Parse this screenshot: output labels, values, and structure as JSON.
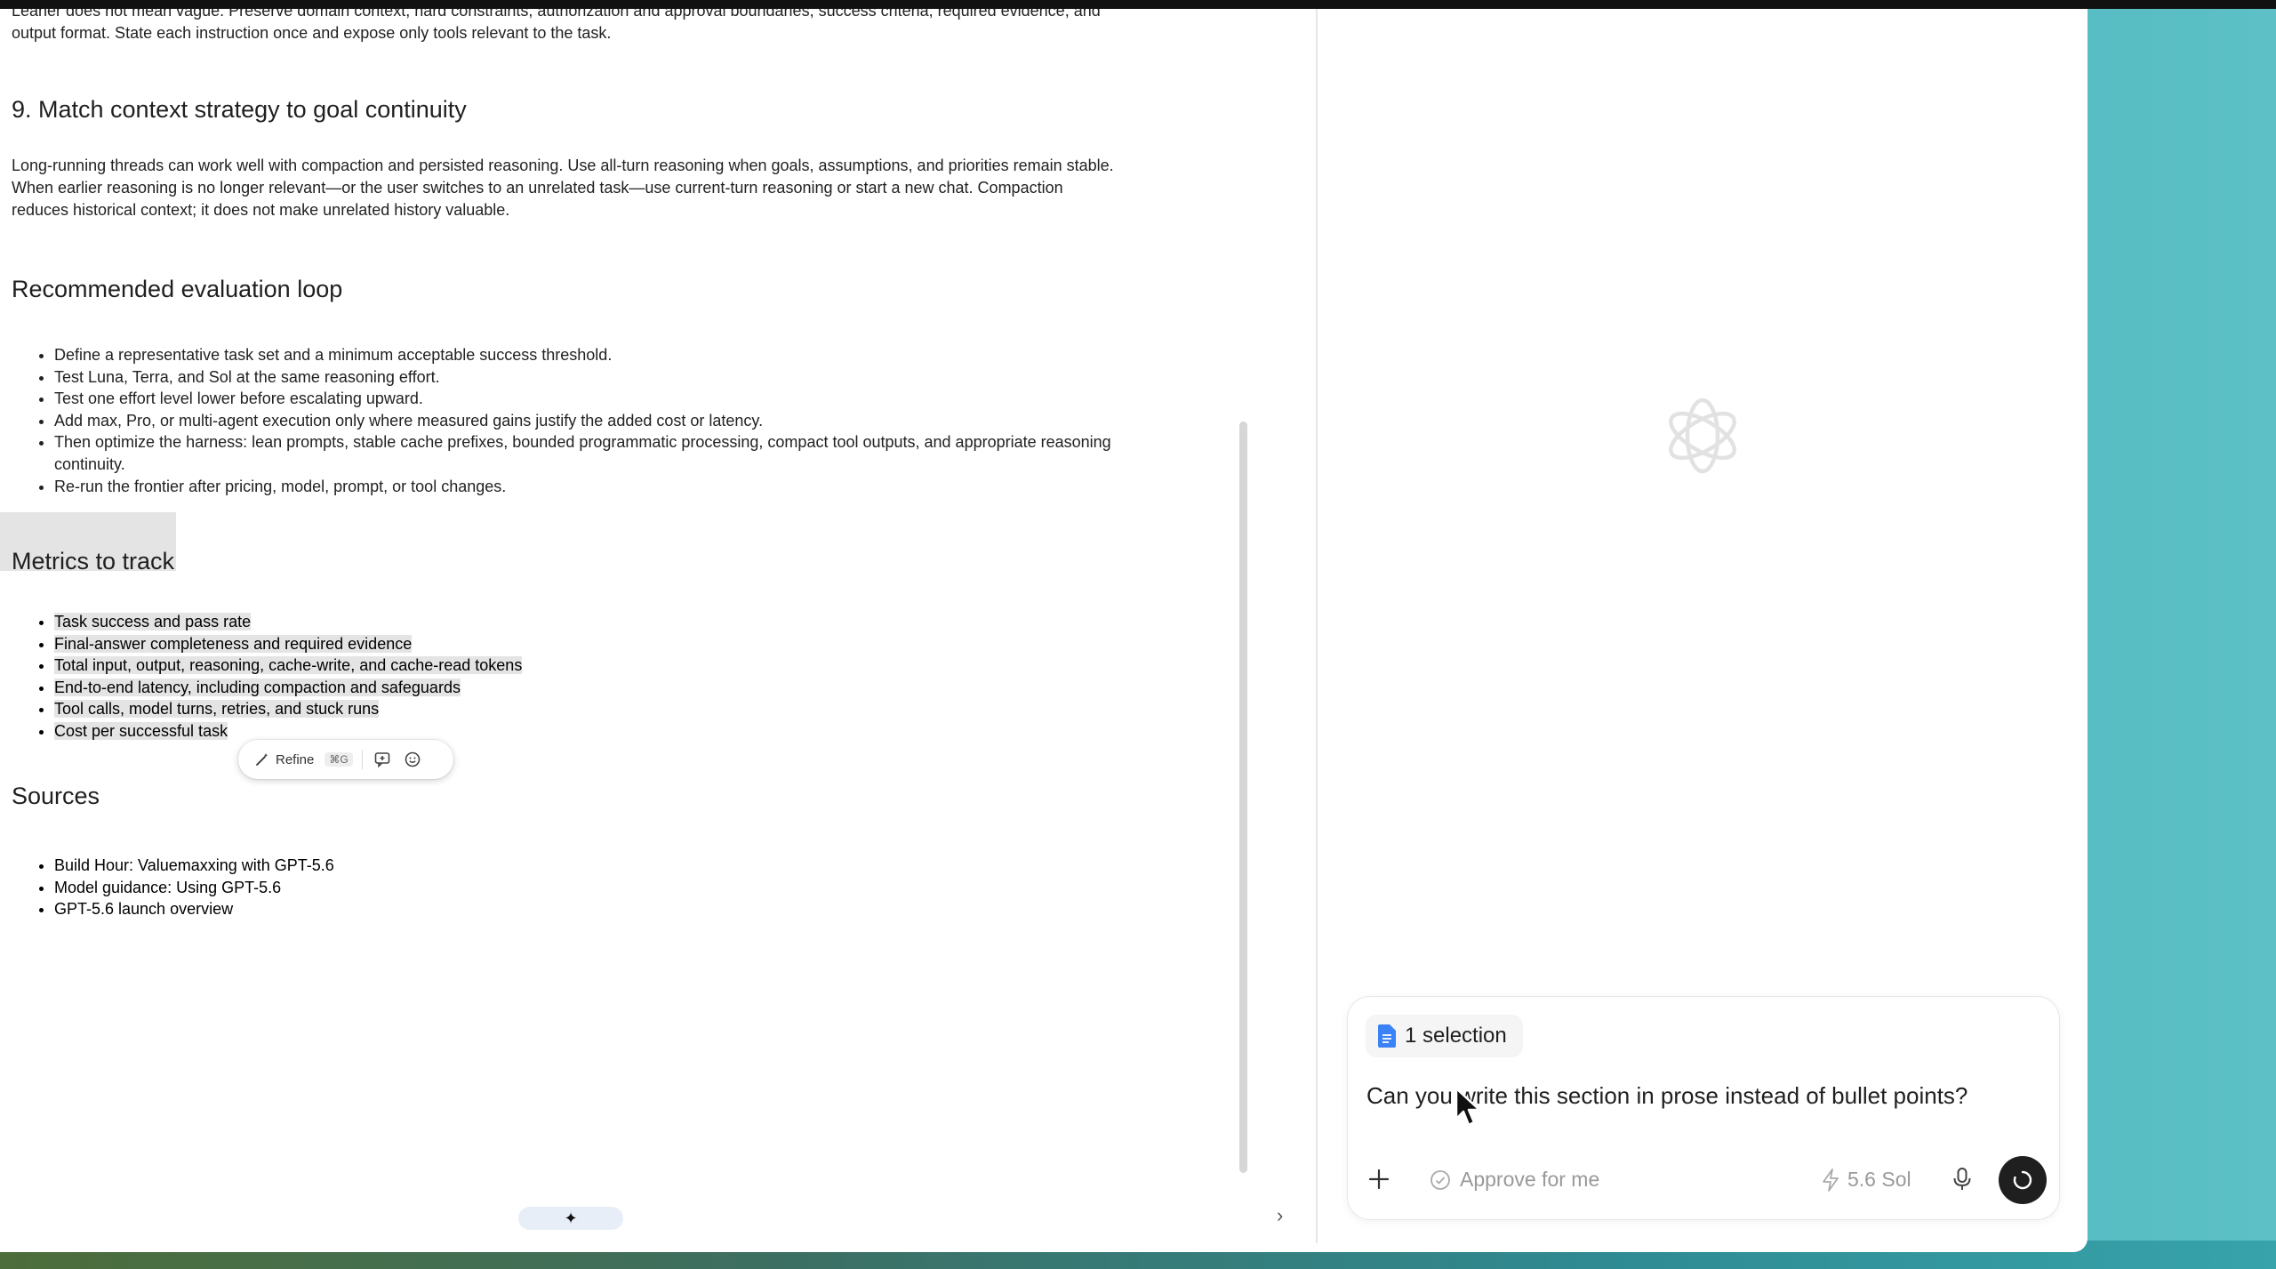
{
  "document": {
    "cut_paragraph": "Leaner does not mean vague. Preserve domain context, hard constraints, authorization and approval boundaries, success criteria, required evidence, and output format. State each instruction once and expose only tools relevant to the task.",
    "section9": {
      "heading": "9. Match context strategy to goal continuity",
      "body": "Long-running threads can work well with compaction and persisted reasoning. Use all-turn reasoning when goals, assumptions, and priorities remain stable. When earlier reasoning is no longer relevant—or the user switches to an unrelated task—use current-turn reasoning or start a new chat. Compaction reduces historical context; it does not make unrelated history valuable."
    },
    "eval_loop": {
      "heading": "Recommended evaluation loop",
      "items": [
        "Define a representative task set and a minimum acceptable success threshold.",
        "Test Luna, Terra, and Sol at the same reasoning effort.",
        "Test one effort level lower before escalating upward.",
        "Add max, Pro, or multi-agent execution only where measured gains justify the added cost or latency.",
        "Then optimize the harness: lean prompts, stable cache prefixes, bounded programmatic processing, compact tool outputs, and appropriate reasoning continuity.",
        "Re-run the frontier after pricing, model, prompt, or tool changes."
      ]
    },
    "metrics": {
      "heading": "Metrics to track",
      "items": [
        "Task success and pass rate",
        "Final-answer completeness and required evidence",
        "Total input, output, reasoning, cache-write, and cache-read tokens",
        "End-to-end latency, including compaction and safeguards",
        "Tool calls, model turns, retries, and stuck runs",
        "Cost per successful task"
      ]
    },
    "sources": {
      "heading": "Sources",
      "items": [
        "Build Hour: Valuemaxxing with GPT-5.6",
        "Model guidance: Using GPT-5.6",
        "GPT-5.6 launch overview"
      ]
    },
    "selection_toolbar": {
      "refine_label": "Refine",
      "shortcut": "⌘G"
    },
    "footer_glyph": "✦",
    "collapse_glyph": "›"
  },
  "chat": {
    "selection_chip": "1 selection",
    "prompt_text": "Can you write this section in prose instead of bullet points?",
    "approve_label": "Approve for me",
    "model_label": "5.6 Sol",
    "accent": "#3b82f6"
  }
}
